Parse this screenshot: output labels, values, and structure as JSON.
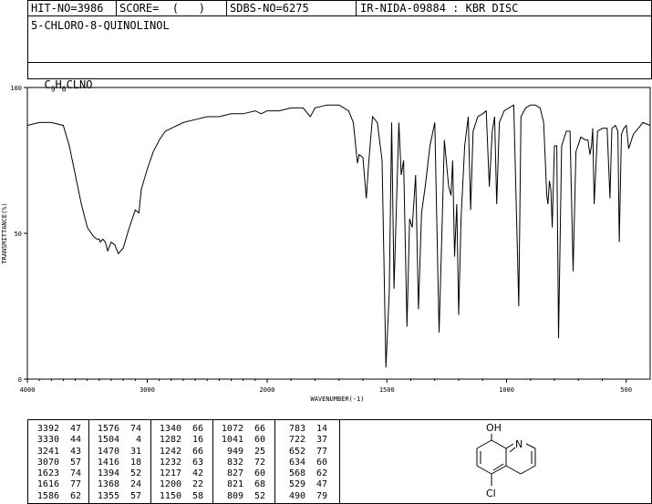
{
  "header": {
    "hit_no": "HIT-NO=3986",
    "score": "SCORE=  (   )",
    "sdbs_no": "SDBS-NO=6275",
    "ir_info": "IR-NIDA-09884 : KBR DISC",
    "compound_name": "5-CHLORO-8-QUINOLINOL",
    "formula_c": "C",
    "formula_c_sub": "9",
    "formula_h": "H",
    "formula_h_sub": "6",
    "formula_rest": "CLNO"
  },
  "chart_data": {
    "type": "line",
    "title": "",
    "xlabel": "WAVENUMBER(-1)",
    "ylabel": "TRANSMITTANCE(%)",
    "xlim": [
      4000,
      400
    ],
    "ylim": [
      0,
      100
    ],
    "x_ticks": [
      4000,
      3000,
      2000,
      1500,
      1000,
      500
    ],
    "y_ticks": [
      0,
      50,
      100
    ],
    "grid": false,
    "series": [
      {
        "x": [
          4000,
          3900,
          3800,
          3700,
          3650,
          3600,
          3550,
          3500,
          3450,
          3420,
          3400,
          3392,
          3370,
          3350,
          3330,
          3300,
          3270,
          3241,
          3200,
          3150,
          3100,
          3070,
          3050,
          3000,
          2950,
          2900,
          2850,
          2800,
          2700,
          2600,
          2500,
          2400,
          2300,
          2200,
          2100,
          2050,
          2000,
          1950,
          1900,
          1850,
          1820,
          1800,
          1750,
          1700,
          1680,
          1660,
          1640,
          1623,
          1616,
          1600,
          1586,
          1576,
          1560,
          1540,
          1520,
          1504,
          1490,
          1480,
          1470,
          1460,
          1450,
          1440,
          1430,
          1416,
          1405,
          1394,
          1380,
          1368,
          1355,
          1340,
          1320,
          1300,
          1282,
          1270,
          1260,
          1242,
          1232,
          1225,
          1217,
          1208,
          1200,
          1190,
          1175,
          1160,
          1150,
          1140,
          1120,
          1100,
          1085,
          1072,
          1060,
          1050,
          1041,
          1030,
          1010,
          990,
          970,
          949,
          940,
          920,
          900,
          880,
          860,
          845,
          832,
          827,
          821,
          815,
          809,
          800,
          790,
          783,
          770,
          750,
          735,
          722,
          710,
          690,
          670,
          660,
          652,
          645,
          640,
          634,
          620,
          600,
          580,
          568,
          560,
          545,
          535,
          529,
          520,
          510,
          500,
          490,
          470,
          450,
          430,
          400
        ],
        "y": [
          87,
          88,
          88,
          87,
          80,
          70,
          60,
          52,
          49,
          48,
          48,
          47,
          48,
          47,
          44,
          47,
          46,
          43,
          45,
          52,
          58,
          57,
          65,
          72,
          78,
          82,
          85,
          86,
          88,
          89,
          90,
          90,
          91,
          91,
          92,
          91,
          92,
          92,
          93,
          93,
          90,
          93,
          94,
          94,
          93,
          92,
          88,
          74,
          77,
          76,
          62,
          74,
          90,
          88,
          75,
          4,
          30,
          88,
          31,
          60,
          88,
          70,
          75,
          18,
          55,
          52,
          70,
          24,
          57,
          66,
          80,
          88,
          16,
          50,
          82,
          66,
          63,
          75,
          42,
          60,
          22,
          55,
          80,
          90,
          58,
          85,
          90,
          91,
          92,
          66,
          85,
          90,
          60,
          88,
          92,
          93,
          94,
          25,
          90,
          93,
          94,
          94,
          93,
          88,
          63,
          60,
          68,
          65,
          52,
          80,
          80,
          14,
          80,
          85,
          85,
          37,
          78,
          83,
          82,
          82,
          77,
          80,
          86,
          60,
          85,
          86,
          86,
          62,
          86,
          87,
          85,
          47,
          84,
          86,
          87,
          79,
          84,
          86,
          88,
          87
        ],
        "name": ""
      }
    ]
  },
  "peak_table": [
    [
      [
        "3392",
        "47"
      ],
      [
        "3330",
        "44"
      ],
      [
        "3241",
        "43"
      ],
      [
        "3070",
        "57"
      ],
      [
        "1623",
        "74"
      ],
      [
        "1616",
        "77"
      ],
      [
        "1586",
        "62"
      ]
    ],
    [
      [
        "1576",
        "74"
      ],
      [
        "1504",
        "4"
      ],
      [
        "1470",
        "31"
      ],
      [
        "1416",
        "18"
      ],
      [
        "1394",
        "52"
      ],
      [
        "1368",
        "24"
      ],
      [
        "1355",
        "57"
      ]
    ],
    [
      [
        "1340",
        "66"
      ],
      [
        "1282",
        "16"
      ],
      [
        "1242",
        "66"
      ],
      [
        "1232",
        "63"
      ],
      [
        "1217",
        "42"
      ],
      [
        "1200",
        "22"
      ],
      [
        "1150",
        "58"
      ]
    ],
    [
      [
        "1072",
        "66"
      ],
      [
        "1041",
        "60"
      ],
      [
        "949",
        "25"
      ],
      [
        "832",
        "72"
      ],
      [
        "827",
        "60"
      ],
      [
        "821",
        "68"
      ],
      [
        "809",
        "52"
      ]
    ],
    [
      [
        "783",
        "14"
      ],
      [
        "722",
        "37"
      ],
      [
        "652",
        "77"
      ],
      [
        "634",
        "60"
      ],
      [
        "568",
        "62"
      ],
      [
        "529",
        "47"
      ],
      [
        "490",
        "79"
      ]
    ]
  ],
  "structure": {
    "oh_label": "OH",
    "n_label": "N",
    "cl_label": "Cl"
  }
}
